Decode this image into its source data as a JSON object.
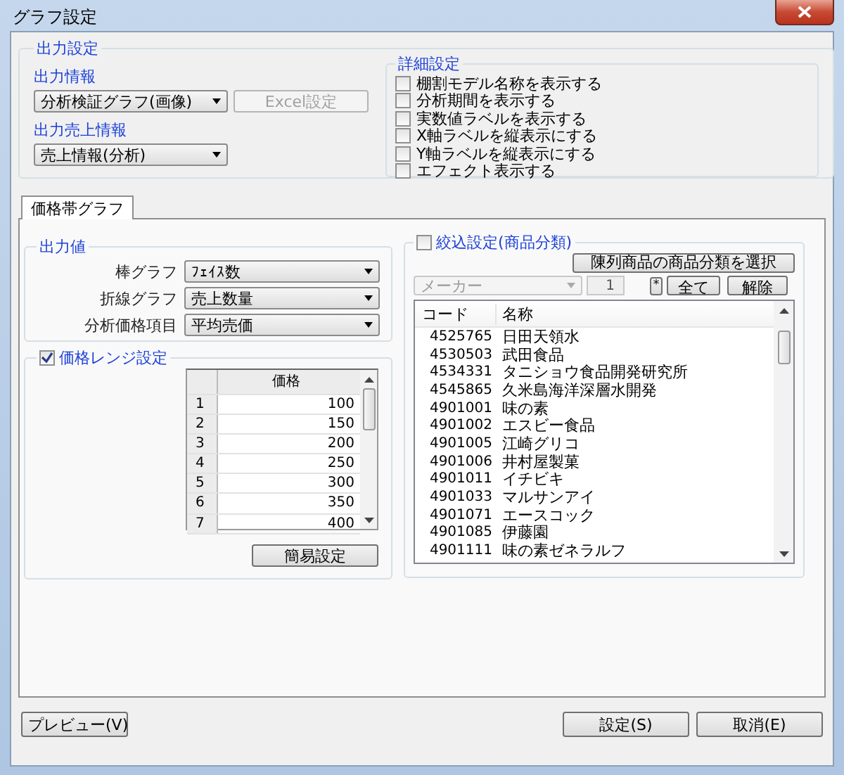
{
  "window": {
    "title": "グラフ設定"
  },
  "output_settings": {
    "title": "出力設定",
    "output_info": {
      "label": "出力情報",
      "value": "分析検証グラフ(画像)"
    },
    "excel_button": {
      "label": "Excel設定",
      "disabled": true
    },
    "sales_info": {
      "label": "出力売上情報",
      "value": "売上情報(分析)"
    },
    "details": {
      "title": "詳細設定",
      "options": [
        {
          "label": "棚割モデル名称を表示する",
          "checked": false
        },
        {
          "label": "分析期間を表示する",
          "checked": false
        },
        {
          "label": "実数値ラベルを表示する",
          "checked": false
        },
        {
          "label": "X軸ラベルを縦表示にする",
          "checked": false
        },
        {
          "label": "Y軸ラベルを縦表示にする",
          "checked": false
        },
        {
          "label": "エフェクト表示する",
          "checked": false
        }
      ]
    }
  },
  "tabs": [
    {
      "label": "価格帯グラフ",
      "selected": true
    }
  ],
  "output_values": {
    "title": "出力値",
    "rows": [
      {
        "label": "棒グラフ",
        "value": "ﾌｪｲｽ数"
      },
      {
        "label": "折線グラフ",
        "value": "売上数量"
      },
      {
        "label": "分析価格項目",
        "value": "平均売価"
      }
    ]
  },
  "price_range": {
    "label": "価格レンジ設定",
    "checked": true,
    "column": "価格",
    "rows": [
      {
        "index": "1",
        "price": "100"
      },
      {
        "index": "2",
        "price": "150"
      },
      {
        "index": "3",
        "price": "200"
      },
      {
        "index": "4",
        "price": "250"
      },
      {
        "index": "5",
        "price": "300"
      },
      {
        "index": "6",
        "price": "350"
      },
      {
        "index": "7",
        "price": "400"
      }
    ],
    "button": "簡易設定"
  },
  "filter": {
    "label": "絞込設定(商品分類)",
    "checked": false,
    "select_button": "陳列商品の商品分類を選択",
    "maker": {
      "placeholder": "メーカー",
      "disabled": true
    },
    "number": {
      "value": "1"
    },
    "star_button": "*",
    "all_button": "全て",
    "clear_button": "解除",
    "columns": [
      "コード",
      "名称"
    ],
    "rows": [
      {
        "code": "4525765",
        "name": "日田天領水"
      },
      {
        "code": "4530503",
        "name": "武田食品"
      },
      {
        "code": "4534331",
        "name": "タニショウ食品開発研究所"
      },
      {
        "code": "4545865",
        "name": "久米島海洋深層水開発"
      },
      {
        "code": "4901001",
        "name": "味の素"
      },
      {
        "code": "4901002",
        "name": "エスビー食品"
      },
      {
        "code": "4901005",
        "name": "江崎グリコ"
      },
      {
        "code": "4901006",
        "name": "井村屋製菓"
      },
      {
        "code": "4901011",
        "name": "イチビキ"
      },
      {
        "code": "4901033",
        "name": "マルサンアイ"
      },
      {
        "code": "4901071",
        "name": "エースコック"
      },
      {
        "code": "4901085",
        "name": "伊藤園"
      },
      {
        "code": "4901111",
        "name": "味の素ゼネラルフ"
      }
    ]
  },
  "buttons": {
    "preview": "プレビュー(V)",
    "ok": "設定(S)",
    "cancel": "取消(E)"
  }
}
